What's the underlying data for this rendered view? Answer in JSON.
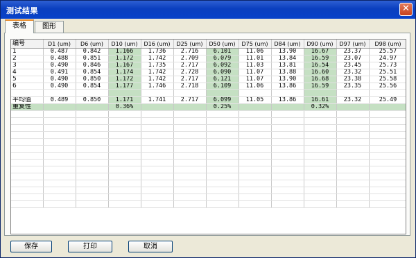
{
  "window": {
    "title": "测试结果",
    "close_glyph": "✕"
  },
  "tabs": [
    {
      "label": "表格",
      "active": true
    },
    {
      "label": "图形",
      "active": false
    }
  ],
  "table": {
    "headers": [
      "编号",
      "D1 (um)",
      "D6 (um)",
      "D10 (um)",
      "D16 (um)",
      "D25 (um)",
      "D50 (um)",
      "D75 (um)",
      "D84 (um)",
      "D90 (um)",
      "D97 (um)",
      "D98 (um)"
    ],
    "rows": [
      [
        "1",
        "0.487",
        "0.842",
        "1.166",
        "1.736",
        "2.716",
        "6.101",
        "11.06",
        "13.90",
        "16.67",
        "23.37",
        "25.57"
      ],
      [
        "2",
        "0.488",
        "0.851",
        "1.172",
        "1.742",
        "2.709",
        "6.079",
        "11.01",
        "13.84",
        "16.59",
        "23.07",
        "24.97"
      ],
      [
        "3",
        "0.490",
        "0.846",
        "1.167",
        "1.735",
        "2.717",
        "6.092",
        "11.03",
        "13.81",
        "16.54",
        "23.45",
        "25.73"
      ],
      [
        "4",
        "0.491",
        "0.854",
        "1.174",
        "1.742",
        "2.728",
        "6.090",
        "11.07",
        "13.88",
        "16.60",
        "23.32",
        "25.51"
      ],
      [
        "5",
        "0.490",
        "0.850",
        "1.172",
        "1.742",
        "2.717",
        "6.121",
        "11.07",
        "13.90",
        "16.68",
        "23.38",
        "25.58"
      ],
      [
        "6",
        "0.490",
        "0.854",
        "1.177",
        "1.746",
        "2.718",
        "6.109",
        "11.06",
        "13.86",
        "16.59",
        "23.35",
        "25.56"
      ]
    ],
    "average": [
      "平均值",
      "0.489",
      "0.850",
      "1.171",
      "1.741",
      "2.717",
      "6.099",
      "11.05",
      "13.86",
      "16.61",
      "23.32",
      "25.49"
    ],
    "repeatability": [
      "重复性",
      "",
      "",
      "0.36%",
      "",
      "",
      "0.25%",
      "",
      "",
      "0.32%",
      "",
      ""
    ]
  },
  "buttons": {
    "save": "保存",
    "print": "打印",
    "cancel": "取消"
  },
  "colors": {
    "highlight": "#c5e0c3",
    "titlebar": "#0a3fbf",
    "window_bg": "#ece9d8"
  }
}
